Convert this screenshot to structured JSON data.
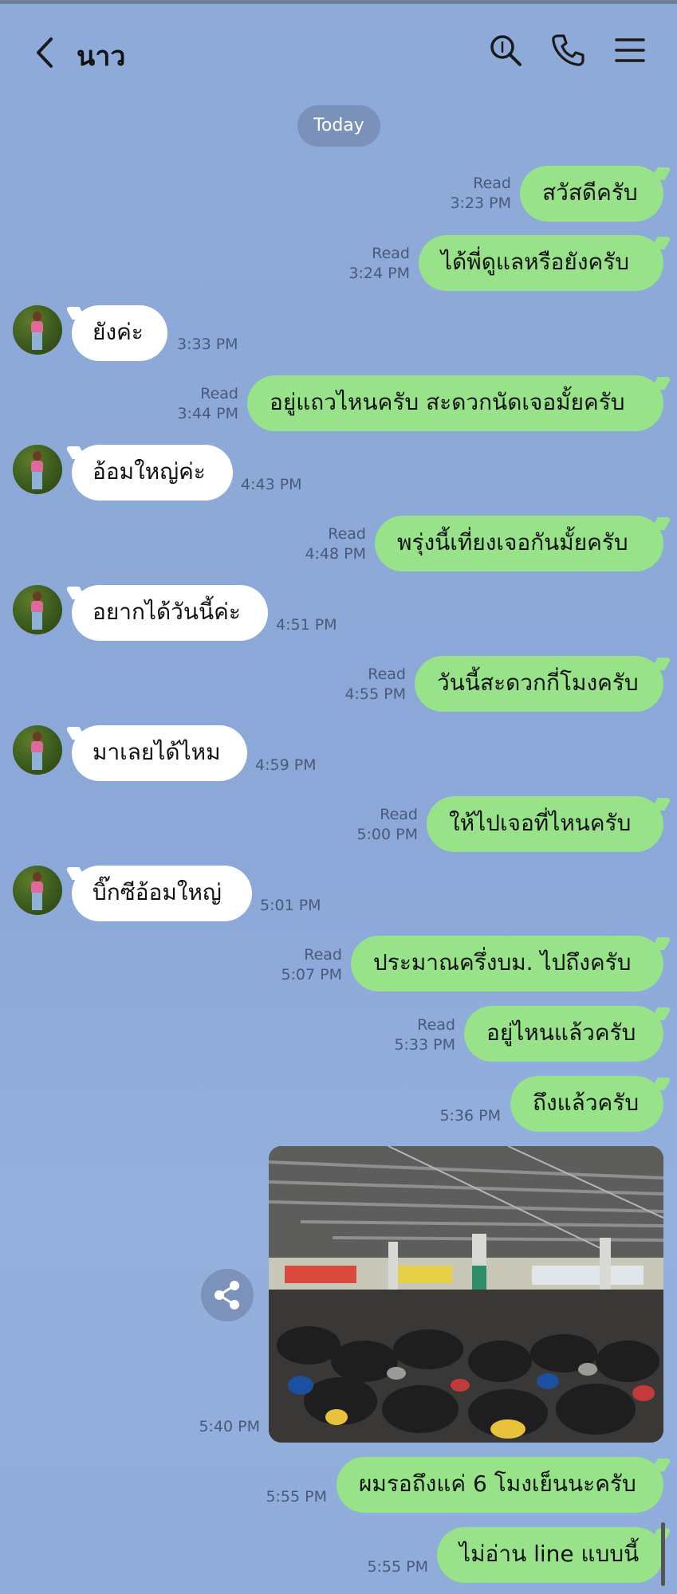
{
  "header": {
    "contact_name": "นาว",
    "back_icon": "chevron-left-icon",
    "search_icon": "search-icon",
    "call_icon": "phone-icon",
    "menu_icon": "menu-icon"
  },
  "date_divider": "Today",
  "colors": {
    "sent_bubble": "#98e28a",
    "received_bubble": "#ffffff",
    "background": "#8eaad9"
  },
  "messages": [
    {
      "dir": "sent",
      "text": "สวัสดีครับ",
      "read": "Read",
      "time": "3:23 PM"
    },
    {
      "dir": "sent",
      "text": "ได้พี่ดูแลหรือยังครับ",
      "read": "Read",
      "time": "3:24 PM"
    },
    {
      "dir": "received",
      "text": "ยังค่ะ",
      "time": "3:33 PM"
    },
    {
      "dir": "sent",
      "text": "อยู่แถวไหนครับ สะดวกนัดเจอมั้ยครับ",
      "read": "Read",
      "time": "3:44 PM"
    },
    {
      "dir": "received",
      "text": "อ้อมใหญ่ค่ะ",
      "time": "4:43 PM"
    },
    {
      "dir": "sent",
      "text": "พรุ่งนี้เที่ยงเจอกันมั้ยครับ",
      "read": "Read",
      "time": "4:48 PM"
    },
    {
      "dir": "received",
      "text": "อยากได้วันนี้ค่ะ",
      "time": "4:51 PM"
    },
    {
      "dir": "sent",
      "text": "วันนี้สะดวกกี่โมงครับ",
      "read": "Read",
      "time": "4:55 PM"
    },
    {
      "dir": "received",
      "text": "มาเลยได้ไหม",
      "time": "4:59 PM"
    },
    {
      "dir": "sent",
      "text": "ให้ไปเจอที่ไหนครับ",
      "read": "Read",
      "time": "5:00 PM"
    },
    {
      "dir": "received",
      "text": "บิ๊กซีอ้อมใหญ่",
      "time": "5:01 PM"
    },
    {
      "dir": "sent",
      "text": "ประมาณครึ่งบม. ไปถึงครับ",
      "read": "Read",
      "time": "5:07 PM"
    },
    {
      "dir": "sent",
      "text": "อยู่ไหนแล้วครับ",
      "read": "Read",
      "time": "5:33 PM"
    },
    {
      "dir": "sent",
      "text": "ถึงแล้วครับ",
      "time": "5:36 PM"
    },
    {
      "dir": "sent",
      "type": "image",
      "alt": "parking-lot-photo",
      "time": "5:40 PM",
      "share_icon": "share-icon"
    },
    {
      "dir": "sent",
      "text": "ผมรอถึงแค่ 6 โมงเย็นนะครับ",
      "time": "5:55 PM"
    },
    {
      "dir": "sent",
      "text": "ไม่อ่าน line แบบนี้",
      "time": "5:55 PM"
    }
  ]
}
